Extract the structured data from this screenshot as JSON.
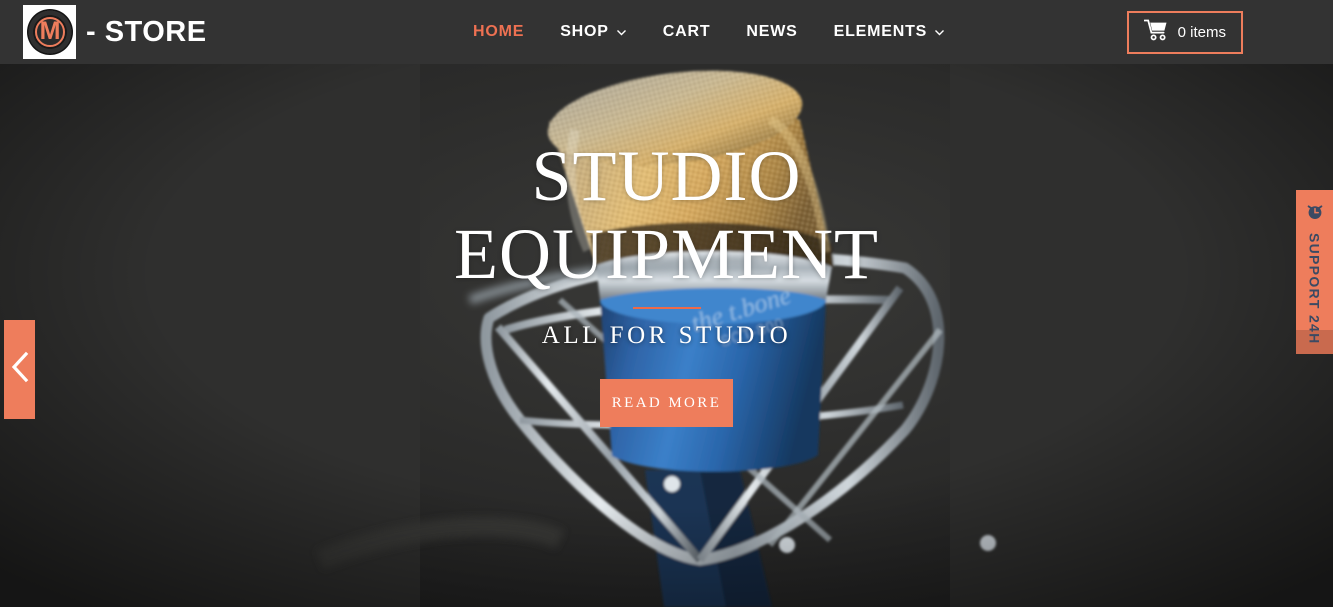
{
  "header": {
    "logo": {
      "icon": "m-circle-logo",
      "letter": "M",
      "brand_text": "- STORE"
    },
    "nav": [
      {
        "label": "HOME",
        "active": true,
        "has_dropdown": false
      },
      {
        "label": "SHOP",
        "active": false,
        "has_dropdown": true
      },
      {
        "label": "CART",
        "active": false,
        "has_dropdown": false
      },
      {
        "label": "NEWS",
        "active": false,
        "has_dropdown": false
      },
      {
        "label": "ELEMENTS",
        "active": false,
        "has_dropdown": true
      }
    ],
    "cart": {
      "icon": "shopping-cart-icon",
      "label": "0 items"
    }
  },
  "hero": {
    "title_line1": "STUDIO",
    "title_line2": "EQUIPMENT",
    "subtitle": "ALL FOR STUDIO",
    "cta_label": "READ MORE",
    "image_alt": "studio condenser microphone in shock mount"
  },
  "slider": {
    "prev_icon": "chevron-left-icon"
  },
  "support": {
    "icon": "alarm-clock-icon",
    "label": "SUPPORT 24H"
  },
  "colors": {
    "accent": "#ee7d5c",
    "accent_dark": "#c96a4e",
    "header_bg": "#333333",
    "hero_bg": "#323232",
    "nav_active": "#ee7152",
    "support_text": "#3b4a63",
    "text_light": "#ffffff"
  }
}
